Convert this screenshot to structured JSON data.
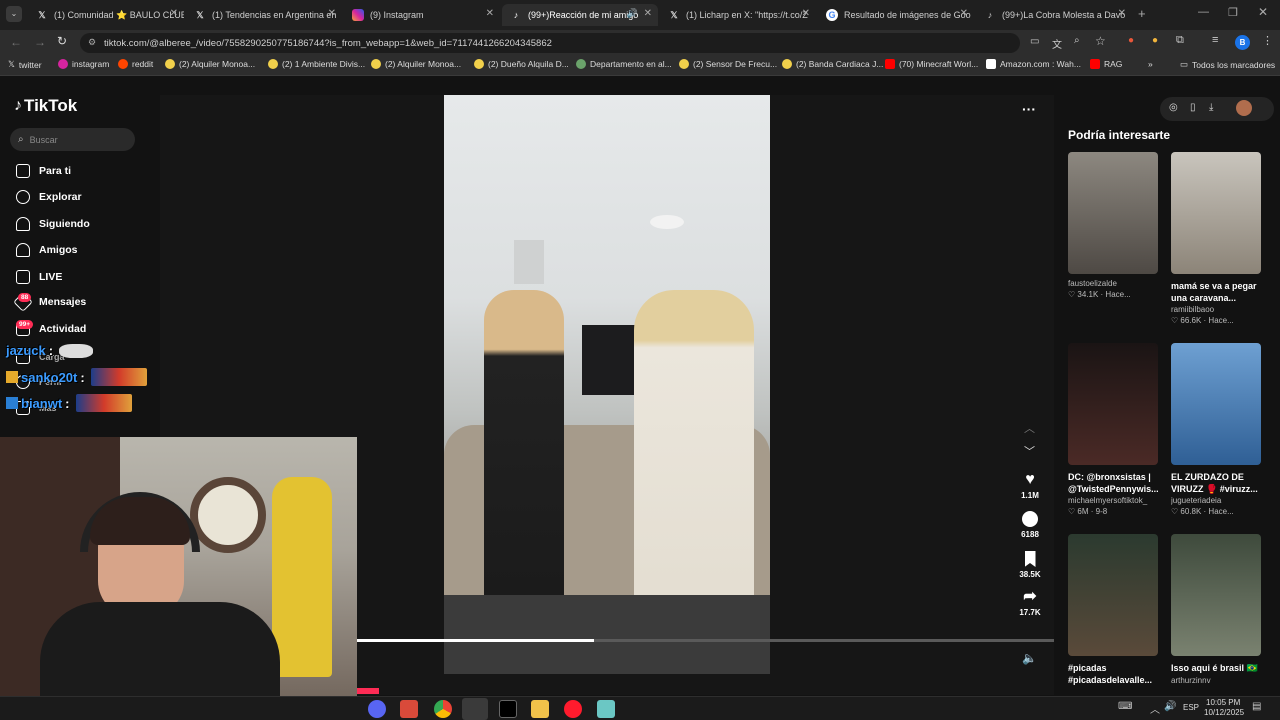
{
  "browser": {
    "tabs": [
      {
        "title": "(1) Comunidad ⭐ BAULO CLUB",
        "icon": "x-logo-icon"
      },
      {
        "title": "(1) Tendencias en Argentina en",
        "icon": "x-logo-icon"
      },
      {
        "title": "(9) Instagram",
        "icon": "instagram-icon"
      },
      {
        "title": "(99+)Reacción de mi amigo",
        "icon": "tiktok-icon"
      },
      {
        "title": "(1) Licharp en X: \"https://t.co/Z",
        "icon": "x-logo-icon"
      },
      {
        "title": "Resultado de imágenes de Goo",
        "icon": "google-icon"
      },
      {
        "title": "(99+)La Cobra Molesta a Davo",
        "icon": "tiktok-icon"
      }
    ],
    "url": "tiktok.com/@alberee_/video/7558290250775186744?is_from_webapp=1&web_id=7117441266204345862",
    "bookmarks": [
      "twitter",
      "instagram",
      "reddit",
      "(2) Alquiler Monoa...",
      "(2) 1 Ambiente Divis...",
      "(2) Alquiler Monoa...",
      "(2) Dueño Alquila D...",
      "Departamento en al...",
      "(2) Sensor De Frecu...",
      "(2) Banda Cardiaca J...",
      "(70) Minecraft Worl...",
      "Amazon.com : Wah...",
      "RAG"
    ],
    "all_bookmarks": "Todos los marcadores",
    "profile_initial": "B"
  },
  "tiktok": {
    "logo": "TikTok",
    "search_placeholder": "Buscar",
    "nav": [
      {
        "label": "Para ti",
        "icon": "home-icon"
      },
      {
        "label": "Explorar",
        "icon": "compass-icon"
      },
      {
        "label": "Siguiendo",
        "icon": "following-icon"
      },
      {
        "label": "Amigos",
        "icon": "friends-icon"
      },
      {
        "label": "LIVE",
        "icon": "live-icon"
      },
      {
        "label": "Mensajes",
        "icon": "messages-icon",
        "badge": "88"
      },
      {
        "label": "Actividad",
        "icon": "activity-icon",
        "badge": "99+"
      },
      {
        "label": "Carga",
        "icon": "upload-icon"
      },
      {
        "label": "Perfil",
        "icon": "profile-icon"
      },
      {
        "label": "Más",
        "icon": "more-icon"
      }
    ],
    "actions": {
      "likes": "1.1M",
      "comments": "6188",
      "saves": "38.5K",
      "shares": "17.7K"
    },
    "progress_fraction": 0.34,
    "suggestions_title": "Podría interesarte",
    "suggestions": [
      {
        "title": "",
        "user": "faustoelizalde",
        "stats": "♡ 34.1K · Hace...",
        "color": "#6d6a66"
      },
      {
        "title": "mamá se va a pegar una caravana...",
        "user": "ramiibilbaoo",
        "stats": "♡ 66.6K · Hace...",
        "color": "#b9b2a6"
      },
      {
        "title": "DC: @bronxsistas | @TwistedPennywis...",
        "user": "michaelmyersoftiktok_",
        "stats": "♡ 6M · 9-8",
        "color": "#2b1f1e"
      },
      {
        "title": "EL ZURDAZO DE VIRUZZ 🥊 #viruzz...",
        "user": "jugueteriadeia",
        "stats": "♡ 60.8K · Hace...",
        "color": "#3a6fa8"
      },
      {
        "title": "#picadas #picadasdelavalle...",
        "user": "",
        "stats": "",
        "color": "#3c4a3a"
      },
      {
        "title": "Isso aqui é brasil 🇧🇷",
        "user": "arthurzinnv",
        "stats": "",
        "color": "#4f5b4e"
      }
    ]
  },
  "chat": [
    {
      "user": "jazuck",
      "sep": ":"
    },
    {
      "user": "sanko20t",
      "sep": ":"
    },
    {
      "user": "bianwt",
      "sep": ":"
    }
  ],
  "taskbar": {
    "time": "10:05 PM",
    "date": "10/12/2025",
    "lang": "ESP"
  }
}
